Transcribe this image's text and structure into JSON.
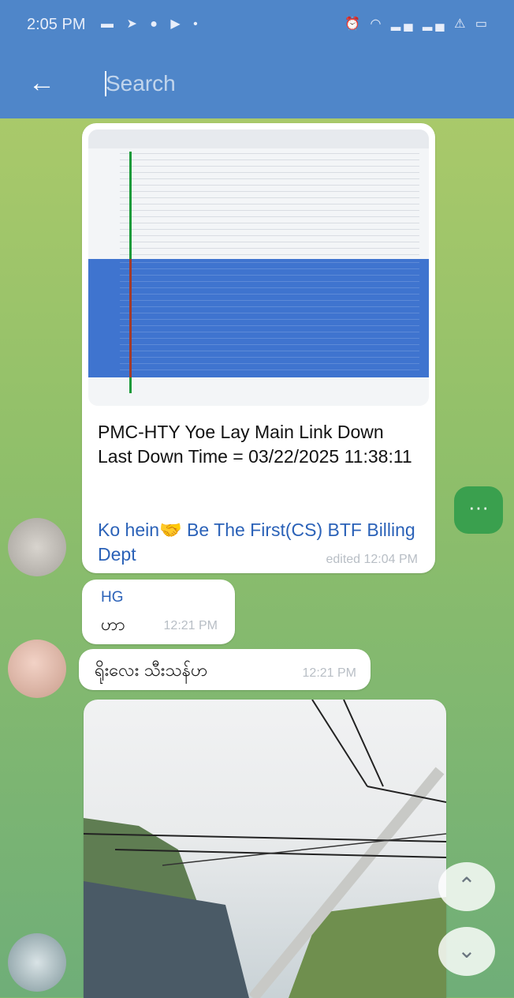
{
  "status_bar": {
    "time": "2:05 PM",
    "left_icons": "▬ ➤ ● ▶ •",
    "right_icons": "⏰ ◠ ▂▄ ▂▄ ⚠ ▭"
  },
  "app_bar": {
    "search_placeholder": "Search"
  },
  "messages": [
    {
      "type": "photo_with_caption",
      "caption_lines": [
        "PMC-HTY Yoe Lay Main Link Down",
        "Last Down Time  =  03/22/2025 11:38:11"
      ],
      "link_text": "Ko hein🤝 Be The First(CS) BTF Billing Dept",
      "meta": "edited 12:04 PM"
    },
    {
      "type": "text",
      "sender": "HG",
      "text": "ဟာ",
      "time": "12:21 PM"
    },
    {
      "type": "text",
      "text": "ရိုးလေး သီးသန်ဟ",
      "time": "12:21 PM"
    },
    {
      "type": "photo"
    }
  ],
  "buttons": {
    "more_label": "···",
    "scroll_up": "⌃",
    "scroll_down": "⌄"
  },
  "colors": {
    "app_bar": "#4f86c9",
    "link": "#2b62b8",
    "accent_green": "#3aa04e"
  }
}
